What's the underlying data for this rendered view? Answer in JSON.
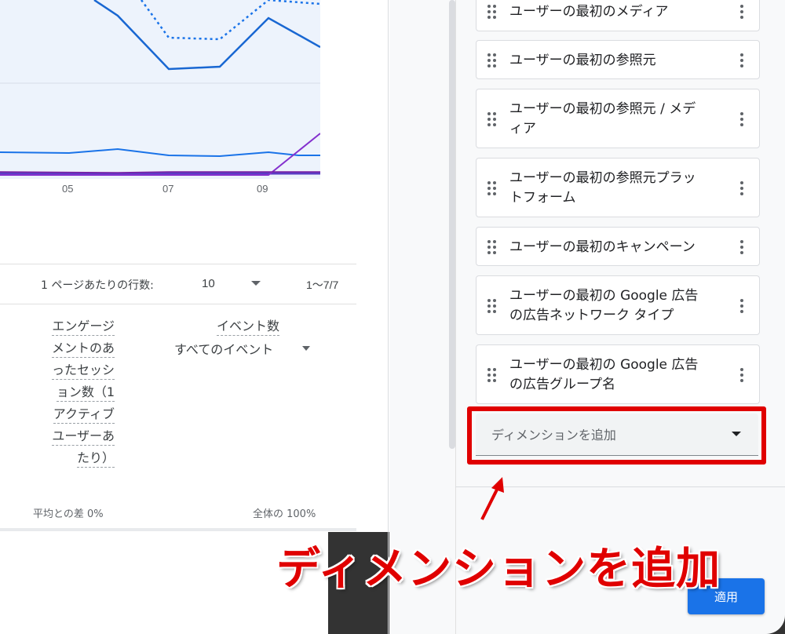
{
  "chart": {
    "x_ticks": [
      "05",
      "07",
      "09"
    ],
    "series_colors": [
      "#1a73e8",
      "#1967d2",
      "#8430ce",
      "#5b3cc4"
    ]
  },
  "table": {
    "rows_per_page_label": "1 ページあたりの行数:",
    "rows_per_page_value": "10",
    "range_label": "1〜7/7",
    "engaged_col_header": [
      "エンゲージ",
      "メントのあ",
      "ったセッシ",
      "ョン数（1",
      "アクティブ",
      "ユーザーあ",
      "たり）"
    ],
    "events_col_header": "イベント数",
    "events_col_filter": "すべてのイベント",
    "engaged_total": "平均との差 0%",
    "events_total": "全体の 100%"
  },
  "panel": {
    "dimensions": [
      [
        "ユーザーの最初のメディア"
      ],
      [
        "ユーザーの最初の参照元"
      ],
      [
        "ユーザーの最初の参照元 / メデ",
        "ィア"
      ],
      [
        "ユーザーの最初の参照元プラッ",
        "トフォーム"
      ],
      [
        "ユーザーの最初のキャンペーン"
      ],
      [
        "ユーザーの最初の Google 広告",
        "の広告ネットワーク タイプ"
      ],
      [
        "ユーザーの最初の Google 広告",
        "の広告グループ名"
      ]
    ],
    "add_dimension_label": "ディメンションを追加",
    "apply_label": "適用"
  },
  "annotation": {
    "callout": "ディメンションを追加",
    "color": "#e00000"
  }
}
